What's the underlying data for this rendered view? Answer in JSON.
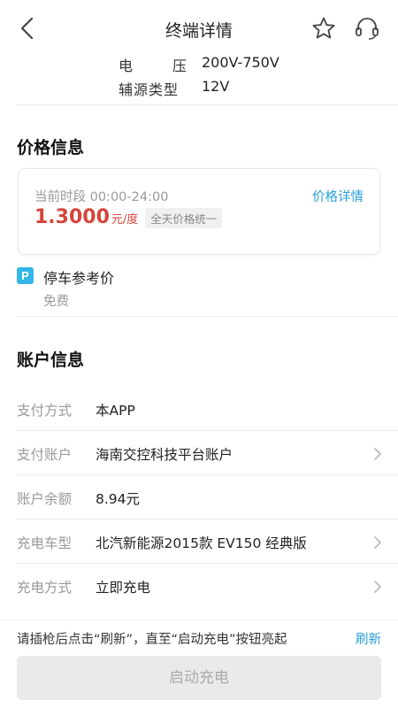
{
  "header": {
    "title": "终端详情",
    "back_icon": "back-chevron-icon",
    "favorite_icon": "star-icon",
    "support_icon": "headset-icon"
  },
  "specs": [
    {
      "label_chars": [
        "电",
        "压"
      ],
      "label": "电压",
      "value": "200V-750V"
    },
    {
      "label": "辅源类型",
      "value": "12V"
    }
  ],
  "price_info": {
    "section_title": "价格信息",
    "period": "当前时段 00:00-24:00",
    "detail_link": "价格详情",
    "price": "1.3000",
    "unit": "元/度",
    "badge": "全天价格统一",
    "accent_color": "#d6453b",
    "link_color": "#2a9fd8"
  },
  "parking": {
    "icon_letter": "P",
    "label": "停车参考价",
    "value": "免费"
  },
  "account_info": {
    "section_title": "账户信息",
    "rows": [
      {
        "label": "支付方式",
        "value": "本APP",
        "has_chevron": false
      },
      {
        "label": "支付账户",
        "value": "海南交控科技平台账户",
        "has_chevron": true
      },
      {
        "label": "账户余额",
        "value": "8.94元",
        "has_chevron": false
      },
      {
        "label": "充电车型",
        "value": "北汽新能源2015款 EV150 经典版",
        "has_chevron": true
      },
      {
        "label": "充电方式",
        "value": "立即充电",
        "has_chevron": true
      }
    ]
  },
  "bottom": {
    "hint": "请插枪后点击“刷新”，直至“启动充电”按钮亮起",
    "refresh": "刷新",
    "start_button": "启动充电"
  }
}
